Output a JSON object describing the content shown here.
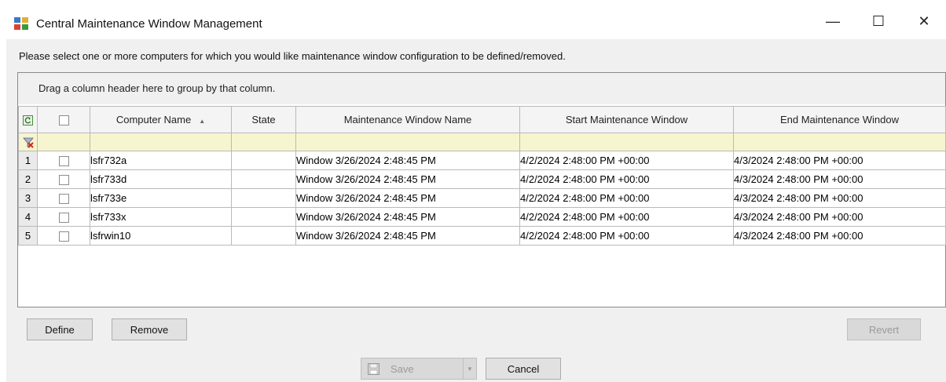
{
  "window": {
    "title": "Central Maintenance Window Management",
    "minimize_glyph": "—",
    "maximize_glyph": "☐",
    "close_glyph": "✕"
  },
  "instruction": "Please select one or more computers for which you would like maintenance window configuration to be defined/removed.",
  "grid": {
    "group_panel_text": "Drag a column header here to group by that column.",
    "columns": {
      "computer_name": "Computer Name",
      "state": "State",
      "maintenance_window_name": "Maintenance Window Name",
      "start": "Start Maintenance Window",
      "end": "End Maintenance Window"
    },
    "rows": [
      {
        "num": "1",
        "computer": "lsfr732a",
        "state": "",
        "window_name": "Window 3/26/2024 2:48:45 PM",
        "start": "4/2/2024 2:48:00 PM +00:00",
        "end": "4/3/2024 2:48:00 PM +00:00"
      },
      {
        "num": "2",
        "computer": "lsfr733d",
        "state": "",
        "window_name": "Window 3/26/2024 2:48:45 PM",
        "start": "4/2/2024 2:48:00 PM +00:00",
        "end": "4/3/2024 2:48:00 PM +00:00"
      },
      {
        "num": "3",
        "computer": "lsfr733e",
        "state": "",
        "window_name": "Window 3/26/2024 2:48:45 PM",
        "start": "4/2/2024 2:48:00 PM +00:00",
        "end": "4/3/2024 2:48:00 PM +00:00"
      },
      {
        "num": "4",
        "computer": "lsfr733x",
        "state": "",
        "window_name": "Window 3/26/2024 2:48:45 PM",
        "start": "4/2/2024 2:48:00 PM +00:00",
        "end": "4/3/2024 2:48:00 PM +00:00"
      },
      {
        "num": "5",
        "computer": "lsfrwin10",
        "state": "",
        "window_name": "Window 3/26/2024 2:48:45 PM",
        "start": "4/2/2024 2:48:00 PM +00:00",
        "end": "4/3/2024 2:48:00 PM +00:00"
      }
    ]
  },
  "buttons": {
    "define": "Define",
    "remove": "Remove",
    "revert": "Revert",
    "save": "Save",
    "cancel": "Cancel"
  },
  "colors": {
    "filter_row": "#f6f5cf",
    "window_bg": "#f0f0f0",
    "filter_icon": "#d9281c"
  },
  "icons": [
    "app-icon",
    "refresh-icon",
    "filter-clear-icon",
    "save-icon",
    "dropdown-arrow-icon"
  ]
}
